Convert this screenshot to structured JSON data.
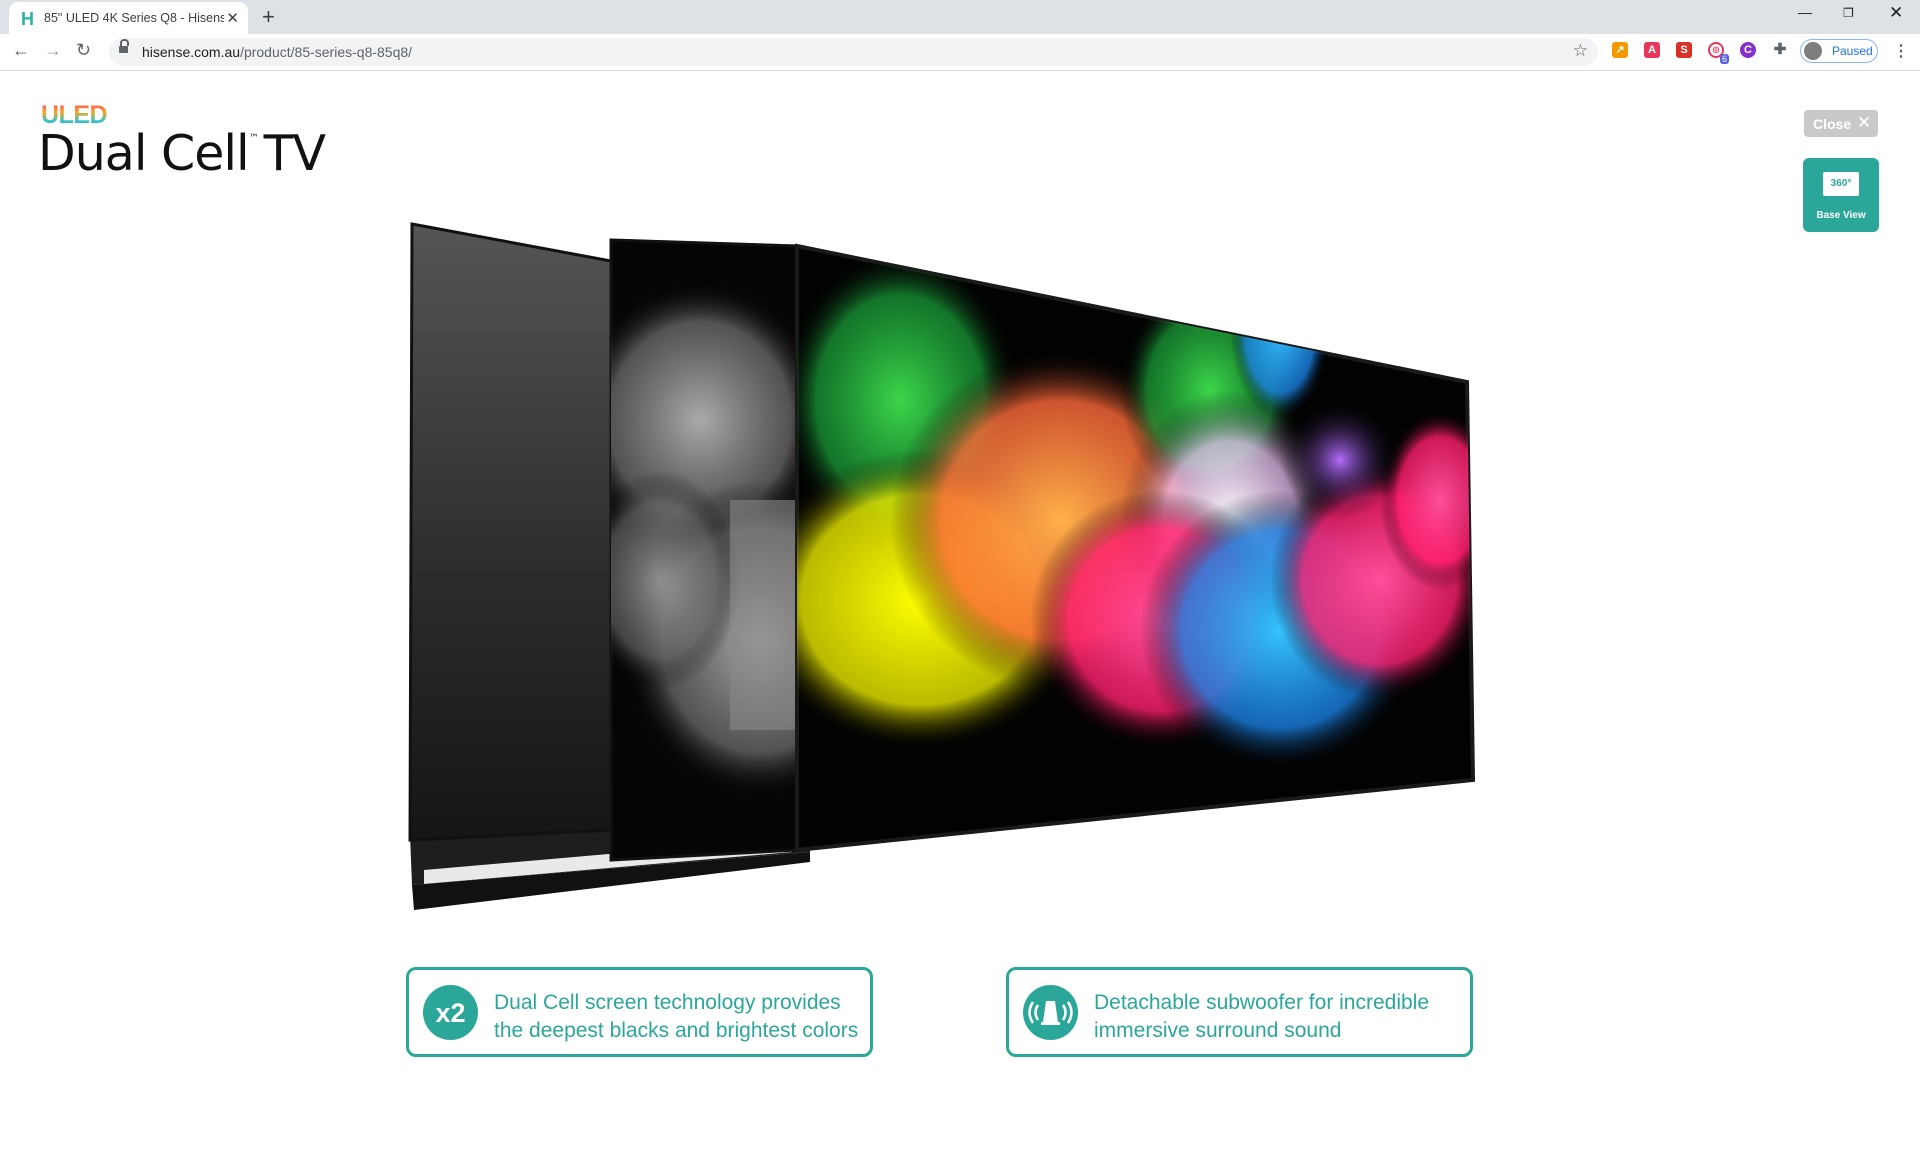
{
  "browser": {
    "tab_title": "85\" ULED 4K Series Q8 - Hisense",
    "tab_favicon": "H",
    "new_tab": "+",
    "url_host": "hisense.com.au",
    "url_path": "/product/85-series-q8-85q8/",
    "profile_status": "Paused",
    "extension_icons": [
      "trend-extension-icon",
      "adobe-acrobat-icon",
      "s-extension-icon",
      "tracker-extension-icon",
      "c-extension-icon",
      "puzzle-extensions-icon"
    ],
    "extension_badge": "6",
    "colors": {
      "tabbar": "#dee1e6",
      "omnibox": "#f1f3f4",
      "profile_text": "#1a73e8"
    }
  },
  "page": {
    "brand": {
      "line1": "ULED",
      "line2": "Dual Cell",
      "trademark": "™",
      "line2_suffix": "TV"
    },
    "close_button": {
      "label": "Close"
    },
    "base_view_button": {
      "badge": "360°",
      "label": "Base View"
    },
    "features": [
      {
        "icon": "x2-icon",
        "icon_text": "x2",
        "text": "Dual Cell screen technology provides the deepest blacks and brightest colors"
      },
      {
        "icon": "subwoofer-sound-icon",
        "text": "Detachable subwoofer for incredible immersive surround sound"
      }
    ],
    "colors": {
      "accent": "#2aa799",
      "close_bg": "#c9c9c9"
    }
  }
}
